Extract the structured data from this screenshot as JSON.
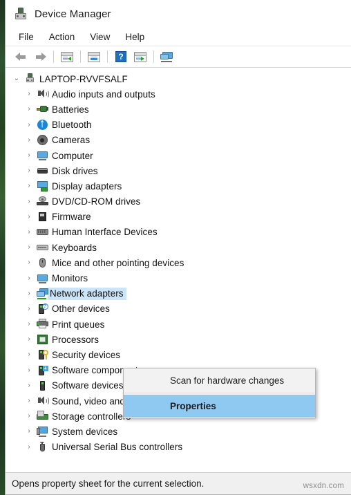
{
  "window": {
    "title": "Device Manager",
    "icon": "device-manager-icon"
  },
  "menubar": {
    "items": [
      {
        "label": "File",
        "name": "menu-file"
      },
      {
        "label": "Action",
        "name": "menu-action"
      },
      {
        "label": "View",
        "name": "menu-view"
      },
      {
        "label": "Help",
        "name": "menu-help"
      }
    ]
  },
  "toolbar": {
    "buttons": [
      {
        "name": "back-button",
        "icon": "arrow-left-icon"
      },
      {
        "name": "forward-button",
        "icon": "arrow-right-icon"
      },
      {
        "name": "show-hide-console-tree-button",
        "icon": "console-tree-icon"
      },
      {
        "name": "properties-button",
        "icon": "properties-window-icon"
      },
      {
        "name": "help-button",
        "icon": "help-question-icon"
      },
      {
        "name": "update-driver-button",
        "icon": "update-driver-icon"
      },
      {
        "name": "scan-for-hardware-changes-button",
        "icon": "scan-hardware-icon"
      }
    ]
  },
  "tree": {
    "root": {
      "label": "LAPTOP-RVVFSALF",
      "icon": "computer-root-icon",
      "expanded": true,
      "chevron": "⌄"
    },
    "chevron_collapsed": "›",
    "items": [
      {
        "label": "Audio inputs and outputs",
        "icon": "speaker-icon",
        "selected": false
      },
      {
        "label": "Batteries",
        "icon": "battery-icon",
        "selected": false
      },
      {
        "label": "Bluetooth",
        "icon": "bluetooth-icon",
        "selected": false
      },
      {
        "label": "Cameras",
        "icon": "camera-icon",
        "selected": false
      },
      {
        "label": "Computer",
        "icon": "monitor-icon",
        "selected": false
      },
      {
        "label": "Disk drives",
        "icon": "disk-drive-icon",
        "selected": false
      },
      {
        "label": "Display adapters",
        "icon": "display-adapter-icon",
        "selected": false
      },
      {
        "label": "DVD/CD-ROM drives",
        "icon": "dvd-drive-icon",
        "selected": false
      },
      {
        "label": "Firmware",
        "icon": "firmware-chip-icon",
        "selected": false
      },
      {
        "label": "Human Interface Devices",
        "icon": "hid-icon",
        "selected": false
      },
      {
        "label": "Keyboards",
        "icon": "keyboard-icon",
        "selected": false
      },
      {
        "label": "Mice and other pointing devices",
        "icon": "mouse-icon",
        "selected": false
      },
      {
        "label": "Monitors",
        "icon": "monitor-icon",
        "selected": false
      },
      {
        "label": "Network adapters",
        "icon": "network-adapter-icon",
        "selected": true
      },
      {
        "label": "Other devices",
        "icon": "other-device-icon",
        "selected": false
      },
      {
        "label": "Print queues",
        "icon": "printer-icon",
        "selected": false
      },
      {
        "label": "Processors",
        "icon": "processor-icon",
        "selected": false
      },
      {
        "label": "Security devices",
        "icon": "security-device-icon",
        "selected": false
      },
      {
        "label": "Software components",
        "icon": "software-component-icon",
        "selected": false
      },
      {
        "label": "Software devices",
        "icon": "software-device-icon",
        "selected": false
      },
      {
        "label": "Sound, video and game controllers",
        "icon": "speaker-icon",
        "selected": false
      },
      {
        "label": "Storage controllers",
        "icon": "storage-controller-icon",
        "selected": false
      },
      {
        "label": "System devices",
        "icon": "system-device-icon",
        "selected": false
      },
      {
        "label": "Universal Serial Bus controllers",
        "icon": "usb-icon",
        "selected": false
      }
    ]
  },
  "context_menu": {
    "items": [
      {
        "label": "Scan for hardware changes",
        "highlighted": false
      },
      {
        "label": "Properties",
        "highlighted": true
      }
    ]
  },
  "statusbar": {
    "text": "Opens property sheet for the current selection."
  },
  "watermark": {
    "text": "wsxdn.com"
  },
  "colors": {
    "selection_blue": "#cce4f7",
    "menu_highlight_blue": "#8fc9f2",
    "desktop_green": "#2d4a2b"
  }
}
